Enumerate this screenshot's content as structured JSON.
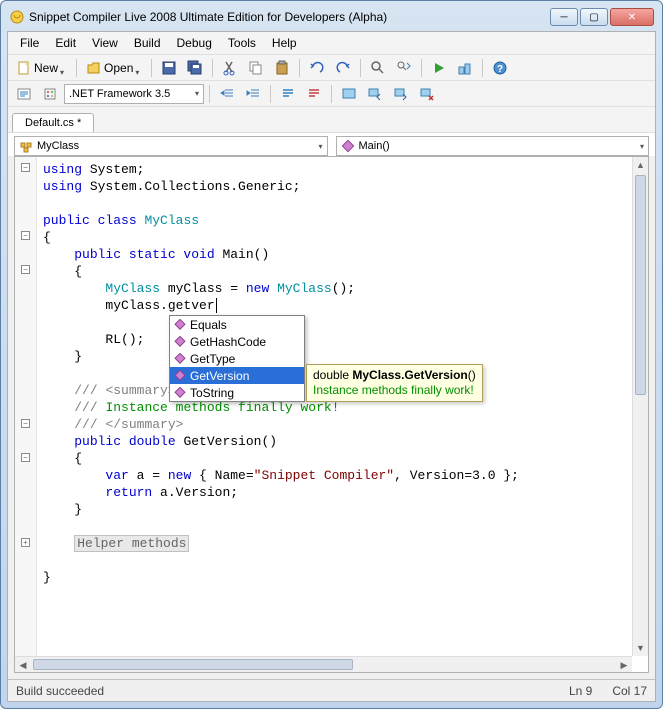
{
  "window": {
    "title": "Snippet Compiler Live 2008 Ultimate Edition for Developers (Alpha)"
  },
  "menu": {
    "file": "File",
    "edit": "Edit",
    "view": "View",
    "build": "Build",
    "debug": "Debug",
    "tools": "Tools",
    "help": "Help"
  },
  "toolbar": {
    "new": "New",
    "open": "Open",
    "framework": ".NET Framework 3.5"
  },
  "tabs": {
    "active": "Default.cs *"
  },
  "nav": {
    "class": "MyClass",
    "member": "Main()"
  },
  "code": {
    "lines": [
      {
        "t": "using System;",
        "kind": "using"
      },
      {
        "t": "using System.Collections.Generic;",
        "kind": "using"
      },
      {
        "t": ""
      },
      {
        "t": "public class MyClass",
        "kind": "classdecl"
      },
      {
        "t": "{"
      },
      {
        "t": "    public static void Main()",
        "kind": "method"
      },
      {
        "t": "    {"
      },
      {
        "t": "        MyClass myClass = new MyClass();",
        "kind": "stmt1"
      },
      {
        "t": "        myClass.getver",
        "kind": "typing"
      },
      {
        "t": ""
      },
      {
        "t": "        RL();",
        "kind": "rl"
      },
      {
        "t": "    }"
      },
      {
        "t": ""
      },
      {
        "t": "    /// <summary>",
        "kind": "docsum"
      },
      {
        "t": "    /// Instance methods finally work!",
        "kind": "docbody"
      },
      {
        "t": "    /// </summary>",
        "kind": "docsum"
      },
      {
        "t": "    public double GetVersion()",
        "kind": "method2"
      },
      {
        "t": "    {"
      },
      {
        "t": "        var a = new { Name=\"Snippet Compiler\", Version=3.0 };",
        "kind": "anon"
      },
      {
        "t": "        return a.Version;",
        "kind": "ret"
      },
      {
        "t": "    }"
      },
      {
        "t": ""
      },
      {
        "t": "    Helper methods",
        "kind": "region"
      },
      {
        "t": ""
      },
      {
        "t": "}"
      }
    ]
  },
  "intellisense": {
    "items": [
      "Equals",
      "GetHashCode",
      "GetType",
      "GetVersion",
      "ToString"
    ],
    "selected": 3
  },
  "tooltip": {
    "sig_pre": "double ",
    "sig_bold": "MyClass.GetVersion",
    "sig_post": "()",
    "summary": "Instance methods finally work!"
  },
  "status": {
    "msg": "Build succeeded",
    "line": "Ln 9",
    "col": "Col 17"
  }
}
